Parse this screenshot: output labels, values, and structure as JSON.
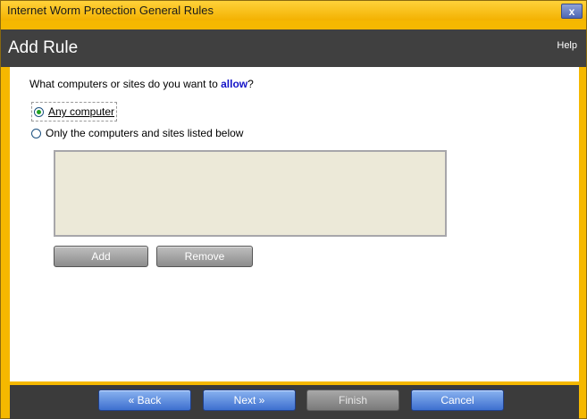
{
  "window": {
    "title": "Internet Worm Protection General Rules",
    "close_label": "x"
  },
  "header": {
    "page_title": "Add Rule",
    "help_label": "Help"
  },
  "content": {
    "question_prefix": "What computers or sites do you want to ",
    "question_emphasis": "allow",
    "question_suffix": "?",
    "options": [
      {
        "label": "Any computer",
        "selected": true
      },
      {
        "label": "Only the computers and sites listed below",
        "selected": false
      }
    ],
    "list_items": [],
    "add_label": "Add",
    "remove_label": "Remove"
  },
  "footer": {
    "back_label": "« Back",
    "next_label": "Next »",
    "finish_label": "Finish",
    "cancel_label": "Cancel"
  },
  "colors": {
    "accent_yellow": "#f5b800",
    "dark_band": "#404040",
    "link_blue": "#1414c8",
    "radio_selected": "#21a121"
  }
}
